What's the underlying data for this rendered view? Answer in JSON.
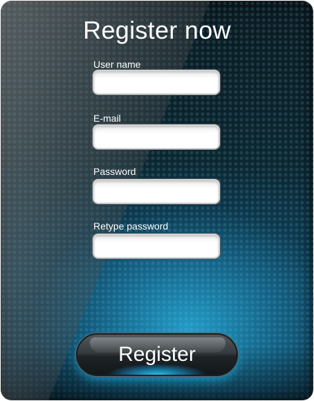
{
  "form": {
    "title": "Register now",
    "fields": [
      {
        "label": "User name",
        "value": "",
        "type": "text"
      },
      {
        "label": "E-mail",
        "value": "",
        "type": "email"
      },
      {
        "label": "Password",
        "value": "",
        "type": "password"
      },
      {
        "label": "Retype password",
        "value": "",
        "type": "password"
      }
    ],
    "submit_label": "Register"
  },
  "colors": {
    "panel_dark": "#0b1a20",
    "panel_glow": "#22a0cd",
    "field_bg": "#ffffff",
    "text": "#ffffff",
    "button_glow": "#28d2ff"
  }
}
